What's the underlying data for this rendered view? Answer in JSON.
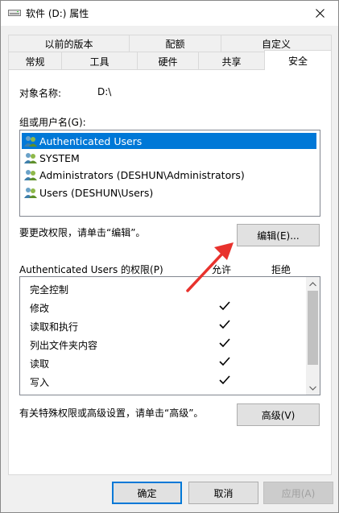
{
  "window": {
    "title": "软件 (D:) 属性"
  },
  "tabs_back": [
    {
      "label": "以前的版本"
    },
    {
      "label": "配额"
    },
    {
      "label": "自定义"
    }
  ],
  "tabs_front": [
    {
      "label": "常规"
    },
    {
      "label": "工具"
    },
    {
      "label": "硬件"
    },
    {
      "label": "共享"
    },
    {
      "label": "安全",
      "active": true
    }
  ],
  "security": {
    "object_label": "对象名称:",
    "object_value": "D:\\",
    "group_label": "组或用户名(G):",
    "users": [
      {
        "name": "Authenticated Users",
        "selected": true
      },
      {
        "name": "SYSTEM"
      },
      {
        "name": "Administrators (DESHUN\\Administrators)"
      },
      {
        "name": "Users (DESHUN\\Users)"
      }
    ],
    "change_hint": "要更改权限，请单击“编辑”。",
    "edit_button": "编辑(E)...",
    "perm_title": "Authenticated Users 的权限(P)",
    "allow_col": "允许",
    "deny_col": "拒绝",
    "permissions": [
      {
        "name": "完全控制",
        "allow": false
      },
      {
        "name": "修改",
        "allow": true
      },
      {
        "name": "读取和执行",
        "allow": true
      },
      {
        "name": "列出文件夹内容",
        "allow": true
      },
      {
        "name": "读取",
        "allow": true
      },
      {
        "name": "写入",
        "allow": true
      }
    ],
    "advanced_hint": "有关特殊权限或高级设置，请单击“高级”。",
    "advanced_button": "高级(V)"
  },
  "footer": {
    "ok": "确定",
    "cancel": "取消",
    "apply": "应用(A)"
  },
  "colors": {
    "accent": "#0078d7",
    "annotation_arrow": "#e8322d"
  }
}
